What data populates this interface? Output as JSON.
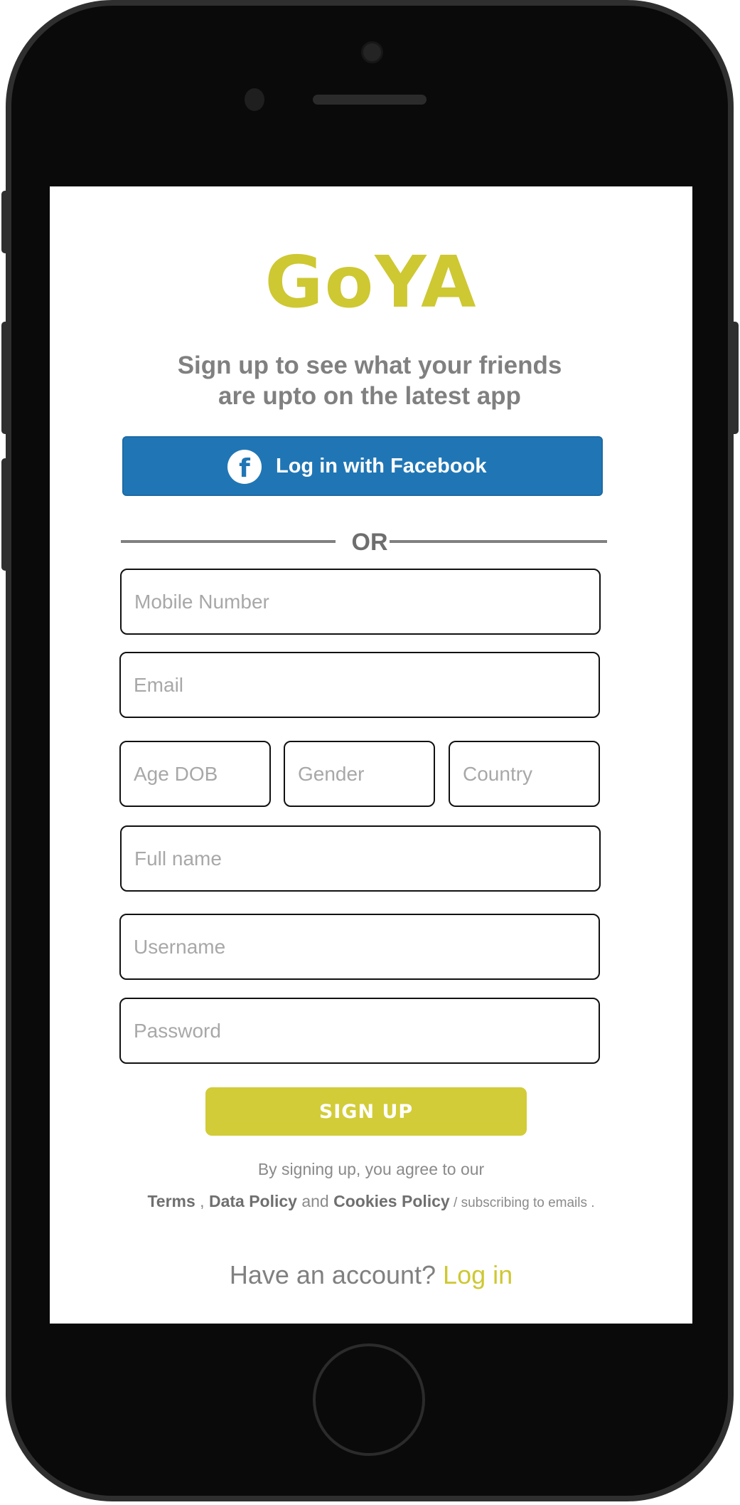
{
  "app": {
    "logo_text": "GoYA",
    "brand_color": "#cec832",
    "tagline_line1": "Sign up to see what your friends",
    "tagline_line2": "are upto on the latest app"
  },
  "facebook": {
    "label": "Log in with Facebook",
    "icon": "facebook-icon",
    "icon_glyph": "f",
    "color": "#2076b5"
  },
  "divider": {
    "label": "OR"
  },
  "form": {
    "mobile_placeholder": "Mobile Number",
    "email_placeholder": "Email",
    "age_placeholder": "Age DOB",
    "gender_placeholder": "Gender",
    "country_placeholder": "Country",
    "fullname_placeholder": "Full name",
    "username_placeholder": "Username",
    "password_placeholder": "Password",
    "signup_label": "SIGN UP",
    "signup_color": "#d2cc38"
  },
  "legal": {
    "agree_text": "By signing up, you agree to our",
    "terms": "Terms",
    "sep1": " , ",
    "data_policy": "Data Policy",
    "and": " and ",
    "cookies_policy": "Cookies Policy",
    "emails": " / subscribing to emails ."
  },
  "account": {
    "prompt": "Have an account? ",
    "login": "Log in"
  }
}
